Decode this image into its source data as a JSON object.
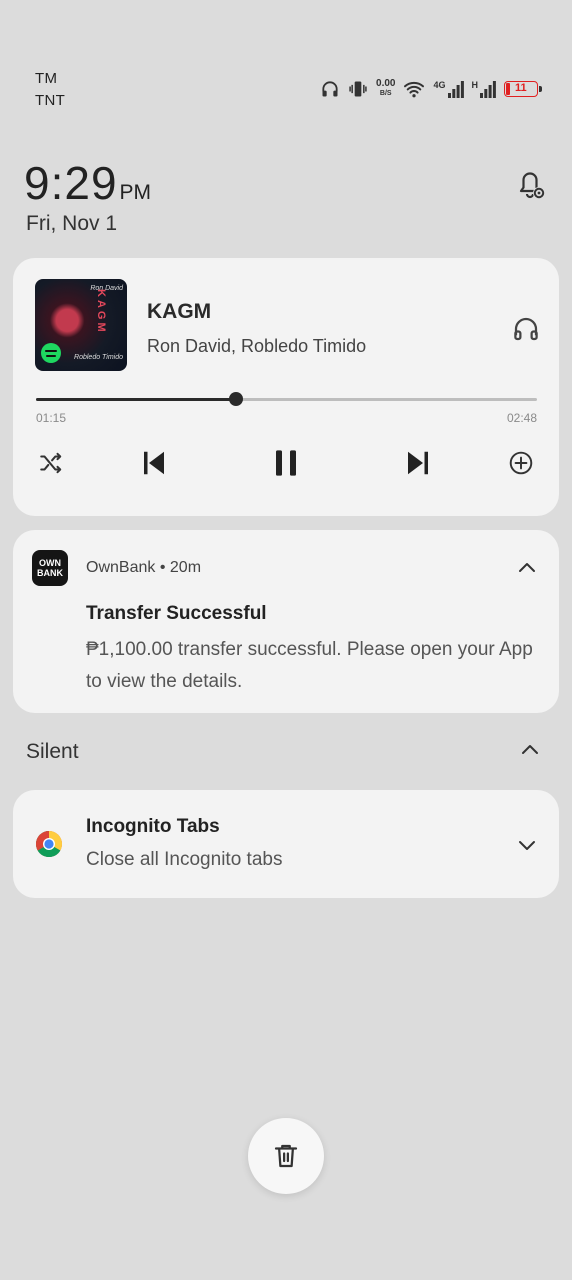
{
  "status_bar": {
    "carrier_1": "TM",
    "carrier_2": "TNT",
    "net_speed_value": "0.00",
    "net_speed_unit": "B/S",
    "sim1_label": "4G",
    "sim2_label": "H",
    "battery": "11",
    "battery_color": "#e02020"
  },
  "clock": {
    "time": "9:29",
    "ampm": "PM",
    "date": "Fri, Nov 1"
  },
  "media": {
    "title": "KAGM",
    "artist": "Ron David, Robledo Timido",
    "album_text": "KAGM",
    "album_sign_top": "Ron David",
    "album_sign_bottom": "Robledo Timido",
    "elapsed": "01:15",
    "total": "02:48",
    "progress_fraction": 0.4
  },
  "notifications": [
    {
      "app": "OwnBank",
      "time": "20m",
      "app_separator": "•",
      "logo_line1": "OWN",
      "logo_line2": "BANK",
      "title": "Transfer Successful",
      "body": "₱1,100.00 transfer successful. Please open your App to view the details."
    }
  ],
  "silent_section": {
    "label": "Silent"
  },
  "silent_notifications": [
    {
      "title": "Incognito Tabs",
      "body": "Close all Incognito tabs"
    }
  ]
}
